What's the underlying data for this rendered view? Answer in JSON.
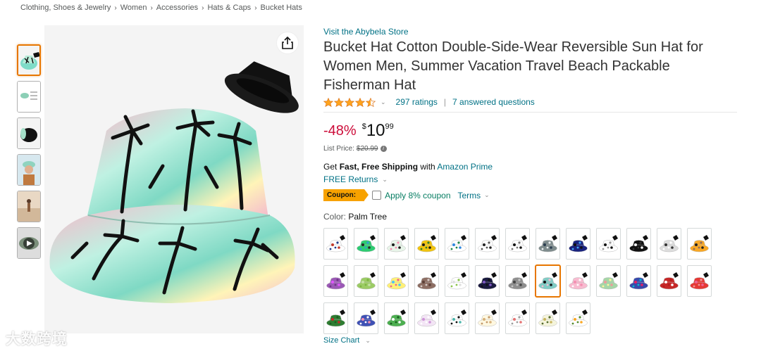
{
  "breadcrumb": [
    "Clothing, Shoes & Jewelry",
    "Women",
    "Accessories",
    "Hats & Caps",
    "Bucket Hats"
  ],
  "breadcrumb_sep": "›",
  "store_link": "Visit the Abybela Store",
  "title": "Bucket Hat Cotton Double-Side-Wear Reversible Sun Hat for Women Men, Summer Vacation Travel Beach Packable Fisherman Hat",
  "rating": {
    "stars": 4.5,
    "ratings_text": "297 ratings",
    "questions_text": "7 answered questions",
    "caret": "⌄"
  },
  "price": {
    "discount": "-48%",
    "currency": "$",
    "whole": "10",
    "fraction": "99",
    "list_label": "List Price:",
    "list_value": "$20.99",
    "info_icon": "i"
  },
  "shipping": {
    "prefix": "Get ",
    "bold": "Fast, Free Shipping",
    "middle": " with ",
    "prime": "Amazon Prime"
  },
  "returns": {
    "label": "FREE Returns",
    "caret": "⌄"
  },
  "coupon": {
    "badge": "Coupon:",
    "apply": "Apply 8% coupon",
    "terms": "Terms",
    "caret": "⌄",
    "checked": false
  },
  "color": {
    "label": "Color: ",
    "value": "Palm Tree"
  },
  "swatches": [
    {
      "c1": "#ffffff",
      "c2": "#c0392b",
      "c3": "#1f3a8a"
    },
    {
      "c1": "#2ecc71",
      "c2": "#2a2a2a",
      "c3": "#3498db"
    },
    {
      "c1": "#e8f5e9",
      "c2": "#1b1b1b",
      "c3": "#f48fb1"
    },
    {
      "c1": "#f1c40f",
      "c2": "#1a1a1a",
      "c3": "#2e7d32"
    },
    {
      "c1": "#ffffff",
      "c2": "#2e86de",
      "c3": "#1e8449"
    },
    {
      "c1": "#ffffff",
      "c2": "#222222",
      "c3": "#555555"
    },
    {
      "c1": "#ffffff",
      "c2": "#111111",
      "c3": "#777777"
    },
    {
      "c1": "#7f8c8d",
      "c2": "#2c3e50",
      "c3": "#ecf0f1"
    },
    {
      "c1": "#1a237e",
      "c2": "#111111",
      "c3": "#42a5f5"
    },
    {
      "c1": "#ffffff",
      "c2": "#111111",
      "c3": "#999999"
    },
    {
      "c1": "#111111",
      "c2": "#ffffff",
      "c3": "#333333"
    },
    {
      "c1": "#dddddd",
      "c2": "#333333",
      "c3": "#ffffff"
    },
    {
      "c1": "#f9a825",
      "c2": "#222222",
      "c3": "#8d6e63"
    },
    {
      "c1": "#9b59b6",
      "c2": "#e056fd",
      "c3": "#6c3483"
    },
    {
      "c1": "#9ccc65",
      "c2": "#c5e1a5",
      "c3": "#7cb342"
    },
    {
      "c1": "#fff176",
      "c2": "#4fc3f7",
      "c3": "#f06292"
    },
    {
      "c1": "#8d6e63",
      "c2": "#5d4037",
      "c3": "#d7ccc8"
    },
    {
      "c1": "#ffffff",
      "c2": "#e0e0e0",
      "c3": "#8bc34a"
    },
    {
      "c1": "#1a1a40",
      "c2": "#7e57c2",
      "c3": "#111111"
    },
    {
      "c1": "#8e8e8e",
      "c2": "#444444",
      "c3": "#c7c7c7"
    },
    {
      "c1": "#80cbc4",
      "c2": "#111111",
      "c3": "#f8bbd0"
    },
    {
      "c1": "#f8bbd0",
      "c2": "#f48fb1",
      "c3": "#ffffff"
    },
    {
      "c1": "#a5d6a7",
      "c2": "#ef9a9a",
      "c3": "#fff59d"
    },
    {
      "c1": "#3949ab",
      "c2": "#e91e63",
      "c3": "#00bcd4"
    },
    {
      "c1": "#c62828",
      "c2": "#ffffff",
      "c3": "#b71c1c"
    },
    {
      "c1": "#e53935",
      "c2": "#f06292",
      "c3": "#ef9a9a"
    },
    {
      "c1": "#2e7d32",
      "c2": "#c62828",
      "c3": "#1b5e20"
    },
    {
      "c1": "#3f51b5",
      "c2": "#f48fb1",
      "c3": "#ffffff"
    },
    {
      "c1": "#4caf50",
      "c2": "#ffffff",
      "c3": "#1b5e20"
    },
    {
      "c1": "#f3e5f5",
      "c2": "#ce93d8",
      "c3": "#ffffff"
    },
    {
      "c1": "#ffffff",
      "c2": "#4db6ac",
      "c3": "#111111"
    },
    {
      "c1": "#fff8e1",
      "c2": "#d7b17a",
      "c3": "#c49a6c"
    },
    {
      "c1": "#ffffff",
      "c2": "#e57373",
      "c3": "#9e9e9e"
    },
    {
      "c1": "#f5f5dc",
      "c2": "#c8b560",
      "c3": "#556b2f"
    },
    {
      "c1": "#ffffff",
      "c2": "#f9a825",
      "c3": "#558b2f"
    }
  ],
  "selected_swatch": 20,
  "size_chart": {
    "label": "Size Chart",
    "caret": "⌄"
  },
  "watermark": "大数跨境",
  "colors": {
    "link": "#007185",
    "discount": "#cc0c39",
    "coupon": "#f7a200",
    "star": "#ffa41c",
    "selected": "#e77600"
  }
}
